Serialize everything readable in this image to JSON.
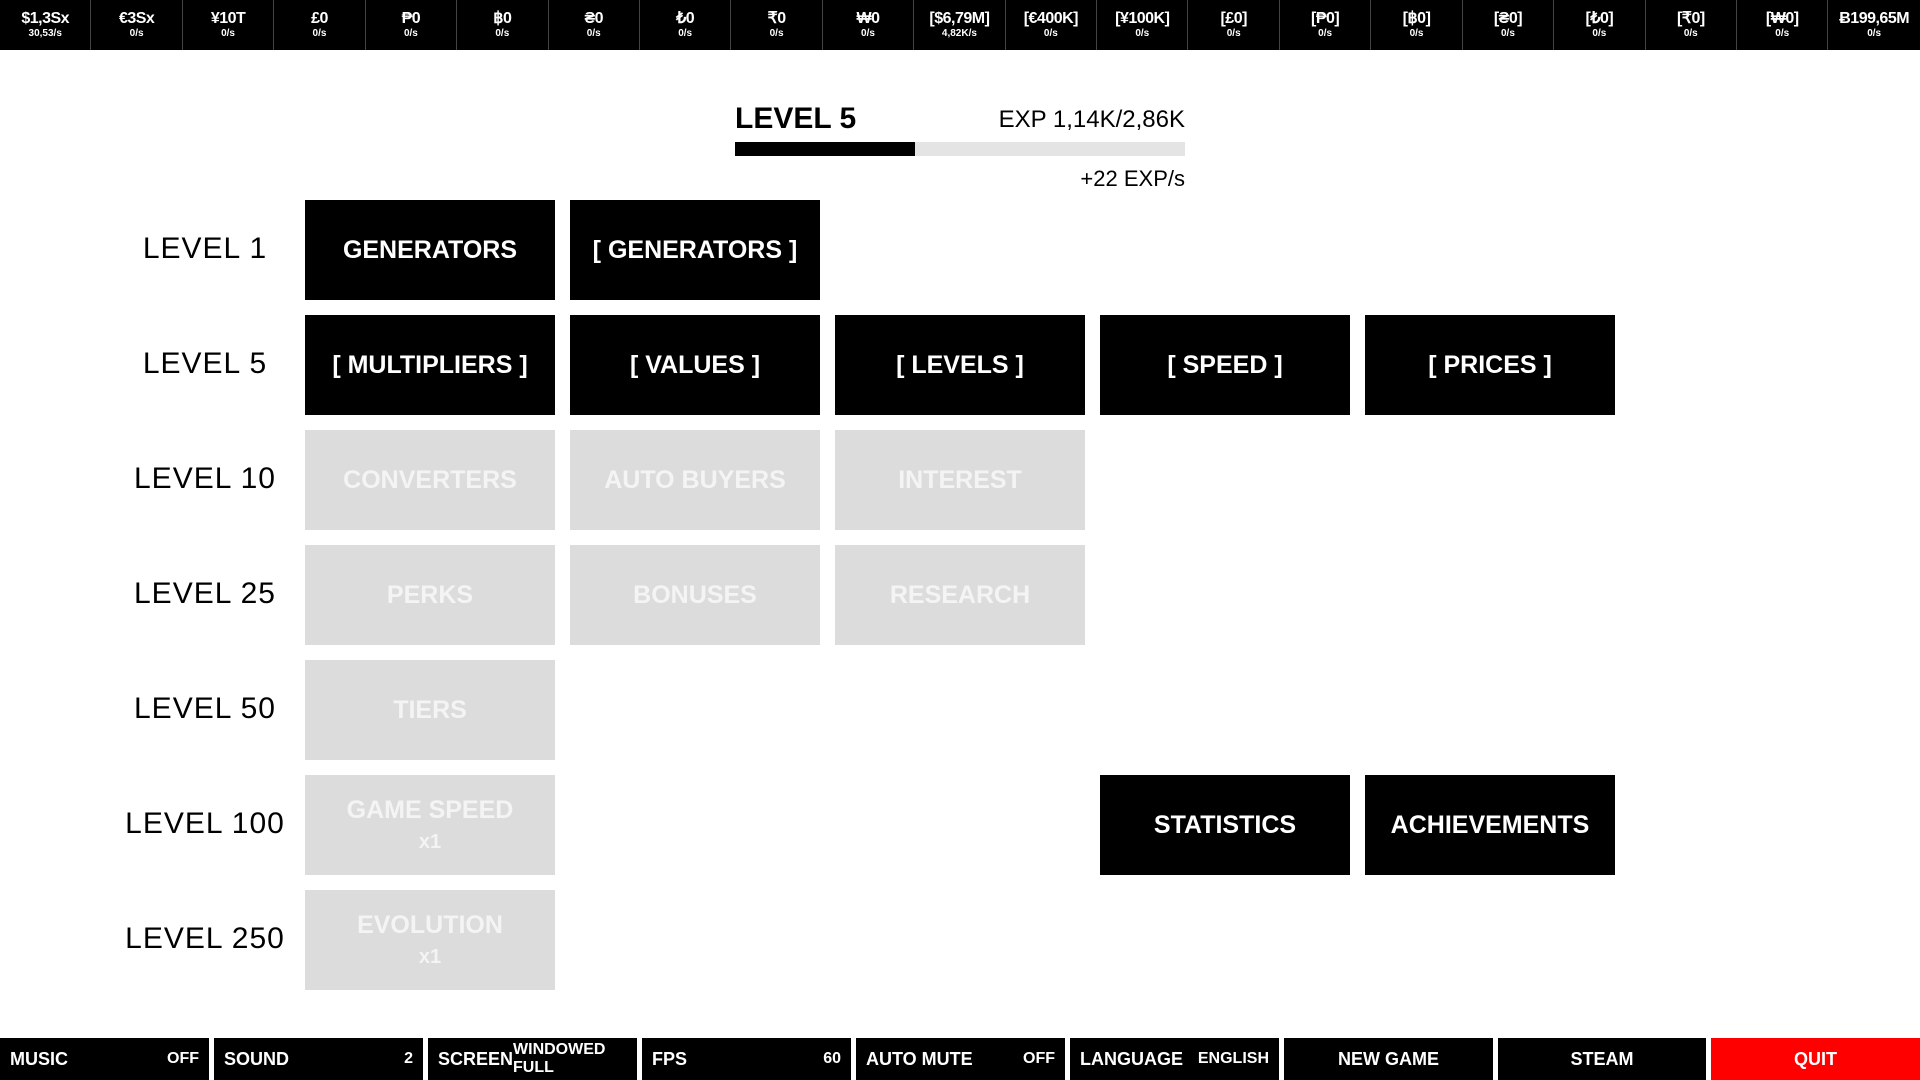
{
  "currencies": [
    {
      "amount": "$1,3Sx",
      "rate": "30,53/s"
    },
    {
      "amount": "€3Sx",
      "rate": "0/s"
    },
    {
      "amount": "¥10T",
      "rate": "0/s"
    },
    {
      "amount": "£0",
      "rate": "0/s"
    },
    {
      "amount": "₱0",
      "rate": "0/s"
    },
    {
      "amount": "฿0",
      "rate": "0/s"
    },
    {
      "amount": "₴0",
      "rate": "0/s"
    },
    {
      "amount": "₺0",
      "rate": "0/s"
    },
    {
      "amount": "₹0",
      "rate": "0/s"
    },
    {
      "amount": "₩0",
      "rate": "0/s"
    },
    {
      "amount": "[$6,79M]",
      "rate": "4,82K/s"
    },
    {
      "amount": "[€400K]",
      "rate": "0/s"
    },
    {
      "amount": "[¥100K]",
      "rate": "0/s"
    },
    {
      "amount": "[£0]",
      "rate": "0/s"
    },
    {
      "amount": "[₱0]",
      "rate": "0/s"
    },
    {
      "amount": "[฿0]",
      "rate": "0/s"
    },
    {
      "amount": "[₴0]",
      "rate": "0/s"
    },
    {
      "amount": "[₺0]",
      "rate": "0/s"
    },
    {
      "amount": "[₹0]",
      "rate": "0/s"
    },
    {
      "amount": "[₩0]",
      "rate": "0/s"
    },
    {
      "amount": "Ƀ199,65M",
      "rate": "0/s"
    }
  ],
  "level": {
    "title": "LEVEL 5",
    "exp": "EXP 1,14K/2,86K",
    "exp_progress": 0.4,
    "exp_rate": "+22 EXP/s"
  },
  "rows": [
    {
      "label": "LEVEL 1",
      "tiles": [
        {
          "label": "GENERATORS",
          "sub": "",
          "enabled": true
        },
        {
          "label": "[ GENERATORS ]",
          "sub": "",
          "enabled": true
        }
      ]
    },
    {
      "label": "LEVEL 5",
      "tiles": [
        {
          "label": "[ MULTIPLIERS ]",
          "sub": "",
          "enabled": true
        },
        {
          "label": "[ VALUES ]",
          "sub": "",
          "enabled": true
        },
        {
          "label": "[ LEVELS ]",
          "sub": "",
          "enabled": true
        },
        {
          "label": "[ SPEED ]",
          "sub": "",
          "enabled": true
        },
        {
          "label": "[ PRICES ]",
          "sub": "",
          "enabled": true
        }
      ]
    },
    {
      "label": "LEVEL 10",
      "tiles": [
        {
          "label": "CONVERTERS",
          "sub": "",
          "enabled": false
        },
        {
          "label": "AUTO BUYERS",
          "sub": "",
          "enabled": false
        },
        {
          "label": "INTEREST",
          "sub": "",
          "enabled": false
        }
      ]
    },
    {
      "label": "LEVEL 25",
      "tiles": [
        {
          "label": "PERKS",
          "sub": "",
          "enabled": false
        },
        {
          "label": "BONUSES",
          "sub": "",
          "enabled": false
        },
        {
          "label": "RESEARCH",
          "sub": "",
          "enabled": false
        }
      ]
    },
    {
      "label": "LEVEL 50",
      "tiles": [
        {
          "label": "TIERS",
          "sub": "",
          "enabled": false
        }
      ]
    },
    {
      "label": "LEVEL 100",
      "tiles": [
        {
          "label": "GAME SPEED",
          "sub": "x1",
          "enabled": false
        }
      ]
    },
    {
      "label": "LEVEL 250",
      "tiles": [
        {
          "label": "EVOLUTION",
          "sub": "x1",
          "enabled": false
        }
      ]
    }
  ],
  "extra_tiles": {
    "statistics": "STATISTICS",
    "achievements": "ACHIEVEMENTS"
  },
  "bottom": {
    "music": {
      "label": "MUSIC",
      "value": "OFF"
    },
    "sound": {
      "label": "SOUND",
      "value": "2"
    },
    "screen": {
      "label": "SCREEN",
      "value": "WINDOWED FULL"
    },
    "fps": {
      "label": "FPS",
      "value": "60"
    },
    "auto_mute": {
      "label": "AUTO MUTE",
      "value": "OFF"
    },
    "language": {
      "label": "LANGUAGE",
      "value": "ENGLISH"
    },
    "new_game": "NEW GAME",
    "steam": "STEAM",
    "quit": "QUIT"
  },
  "colors": {
    "quit": "#ff0000",
    "enabled_tile": "#000000",
    "disabled_tile": "#dcdcdc"
  }
}
